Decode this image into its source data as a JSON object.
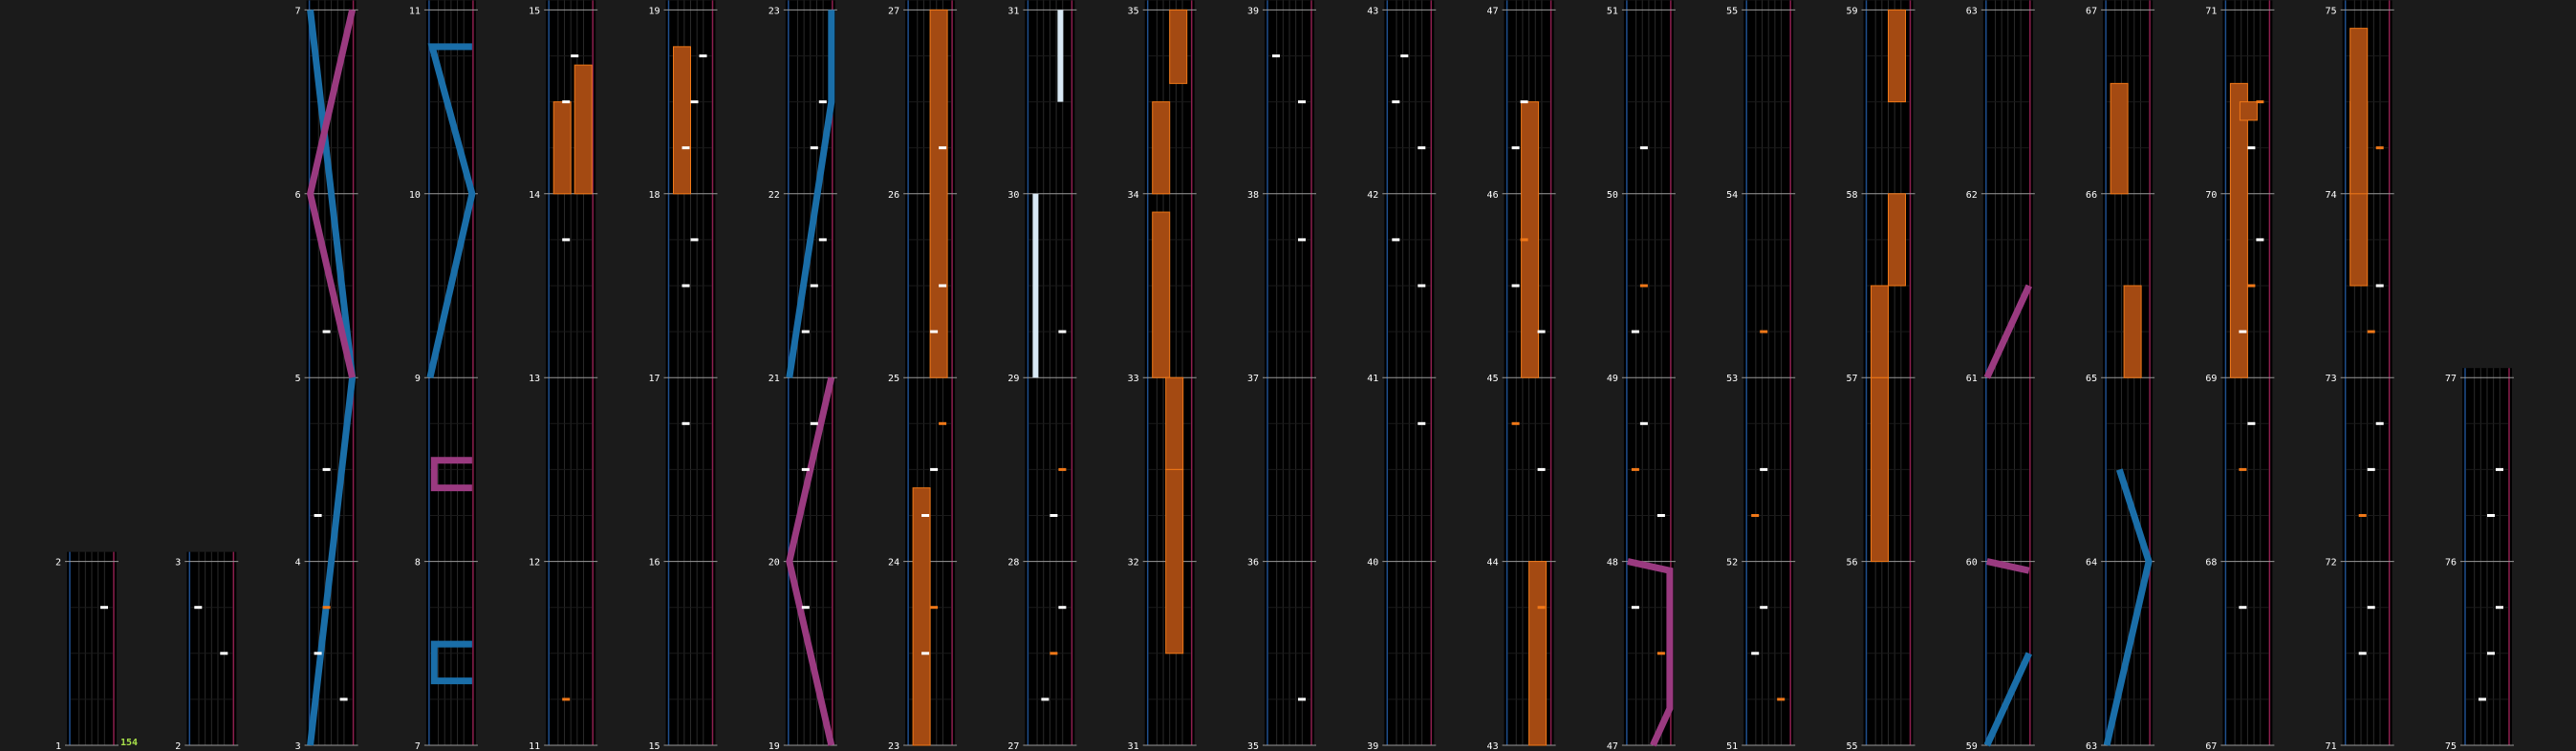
{
  "chart": {
    "total_measures": 77,
    "combo_label": "154",
    "colors": {
      "background": "#1b1b1b",
      "lane_bg": "#000000",
      "grid_line": "#2a2a2a",
      "left_border": "#1f4e8c",
      "right_border": "#8c1f4e",
      "measure_line": "#9a9a9a",
      "label": "#ffffff",
      "combo": "#a8e04a",
      "tap_note": "#ffffff",
      "orange_note": "#f07818",
      "hold_fill": "#a44a12",
      "hold_edge": "#f07818",
      "blue_laser": "#1a6ea8",
      "pink_laser": "#9a3a80",
      "fx_hold": "#d8e8f4"
    },
    "columns": [
      {
        "measures": [
          1,
          2
        ],
        "label_top": "2",
        "label_bottom": "1"
      },
      {
        "measures": [
          2,
          3
        ],
        "label_top": "3",
        "label_bottom": "2"
      },
      {
        "measures": [
          3,
          4,
          5,
          6,
          7
        ],
        "labels": [
          "3",
          "4",
          "5",
          "6",
          "7"
        ]
      },
      {
        "measures": [
          7,
          8,
          9,
          10,
          11
        ],
        "labels": [
          "7",
          "8",
          "9",
          "10",
          "11"
        ]
      },
      {
        "measures": [
          11,
          12,
          13,
          14,
          15
        ],
        "labels": [
          "11",
          "12",
          "13",
          "14",
          "15"
        ]
      },
      {
        "measures": [
          15,
          16,
          17,
          18,
          19
        ],
        "labels": [
          "15",
          "16",
          "17",
          "18",
          "19"
        ]
      },
      {
        "measures": [
          19,
          20,
          21,
          22,
          23
        ],
        "labels": [
          "19",
          "20",
          "21",
          "22",
          "23"
        ]
      },
      {
        "measures": [
          23,
          24,
          25,
          26,
          27
        ],
        "labels": [
          "23",
          "24",
          "25",
          "26",
          "27"
        ]
      },
      {
        "measures": [
          27,
          28,
          29,
          30,
          31
        ],
        "labels": [
          "27",
          "28",
          "29",
          "30",
          "31"
        ]
      },
      {
        "measures": [
          31,
          32,
          33,
          34,
          35
        ],
        "labels": [
          "31",
          "32",
          "33",
          "34",
          "35"
        ]
      },
      {
        "measures": [
          35,
          36,
          37,
          38,
          39
        ],
        "labels": [
          "35",
          "36",
          "37",
          "38",
          "39"
        ]
      },
      {
        "measures": [
          39,
          40,
          41,
          42,
          43
        ],
        "labels": [
          "39",
          "40",
          "41",
          "42",
          "43"
        ]
      },
      {
        "measures": [
          43,
          44,
          45,
          46,
          47
        ],
        "labels": [
          "43",
          "44",
          "45",
          "46",
          "47"
        ]
      },
      {
        "measures": [
          47,
          48,
          49,
          50,
          51
        ],
        "labels": [
          "47",
          "48",
          "49",
          "50",
          "51"
        ]
      },
      {
        "measures": [
          51,
          52,
          53,
          54,
          55
        ],
        "labels": [
          "51",
          "52",
          "53",
          "54",
          "55"
        ]
      },
      {
        "measures": [
          55,
          56,
          57,
          58,
          59
        ],
        "labels": [
          "55",
          "56",
          "57",
          "58",
          "59"
        ]
      },
      {
        "measures": [
          59,
          60,
          61,
          62,
          63
        ],
        "labels": [
          "59",
          "60",
          "61",
          "62",
          "63"
        ]
      },
      {
        "measures": [
          63,
          64,
          65,
          66,
          67
        ],
        "labels": [
          "63",
          "64",
          "65",
          "66",
          "67"
        ]
      },
      {
        "measures": [
          67,
          68,
          69,
          70,
          71
        ],
        "labels": [
          "67",
          "68",
          "69",
          "70",
          "71"
        ]
      },
      {
        "measures": [
          71,
          72,
          73,
          74,
          75
        ],
        "labels": [
          "71",
          "72",
          "73",
          "74",
          "75"
        ]
      },
      {
        "measures": [
          75,
          76,
          77
        ],
        "labels": [
          "75",
          "76",
          "77"
        ]
      }
    ]
  }
}
